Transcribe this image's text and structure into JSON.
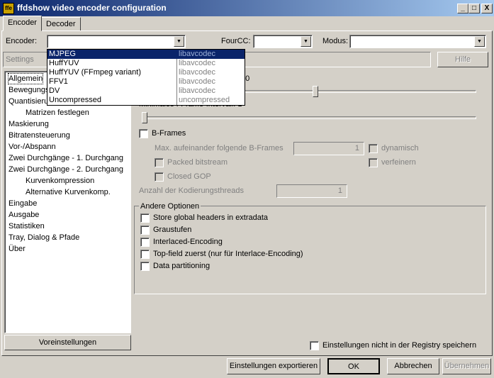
{
  "window": {
    "title": "ffdshow video encoder configuration",
    "icon_text": "ffe",
    "buttons": [
      "_",
      "□",
      "X"
    ]
  },
  "tabs": [
    {
      "label": "Encoder",
      "active": true
    },
    {
      "label": "Decoder",
      "active": false
    }
  ],
  "top": {
    "encoder_label": "Encoder:",
    "encoder_value": "",
    "fourcc_label": "FourCC:",
    "fourcc_value": "",
    "modus_label": "Modus:",
    "modus_value": "",
    "settings_label": "Settings",
    "help_button": "Hilfe"
  },
  "dropdown": {
    "items": [
      {
        "name": "MJPEG",
        "lib": "libavcodec",
        "selected": true
      },
      {
        "name": "HuffYUV",
        "lib": "libavcodec",
        "selected": false
      },
      {
        "name": "HuffYUV (FFmpeg variant)",
        "lib": "libavcodec",
        "selected": false
      },
      {
        "name": "FFV1",
        "lib": "libavcodec",
        "selected": false
      },
      {
        "name": "DV",
        "lib": "libavcodec",
        "selected": false
      },
      {
        "name": "Uncompressed",
        "lib": "uncompressed",
        "selected": false
      }
    ]
  },
  "tree": {
    "items": [
      {
        "label": "Allgemein",
        "indent": 0,
        "selected": true
      },
      {
        "label": "Bewegungs",
        "indent": 0
      },
      {
        "label": "Quantisieru",
        "indent": 0
      },
      {
        "label": "Matrizen festlegen",
        "indent": 1
      },
      {
        "label": "Maskierung",
        "indent": 0
      },
      {
        "label": "Bitratensteuerung",
        "indent": 0
      },
      {
        "label": "Vor-/Abspann",
        "indent": 0
      },
      {
        "label": "Zwei Durchgänge - 1. Durchgang",
        "indent": 0
      },
      {
        "label": "Zwei Durchgänge - 2. Durchgang",
        "indent": 0
      },
      {
        "label": "Kurvenkompression",
        "indent": 1
      },
      {
        "label": "Alternative Kurvenkomp.",
        "indent": 1
      },
      {
        "label": "Eingabe",
        "indent": 0
      },
      {
        "label": "Ausgabe",
        "indent": 0
      },
      {
        "label": "Statistiken",
        "indent": 0
      },
      {
        "label": "Tray, Dialog & Pfade",
        "indent": 0
      },
      {
        "label": "Über",
        "indent": 0
      }
    ]
  },
  "presets_button": "Voreinstellungen",
  "main": {
    "slider1_label_partial": "50",
    "slider1_level": 0.52,
    "slider2_label": "Minimales I-Frame-Intervall: 1",
    "slider2_level": 0.0,
    "bframes_label": "B-Frames",
    "max_bframes_label": "Max. aufeinander folgende B-Frames",
    "max_bframes_value": "1",
    "dynamisch_label": "dynamisch",
    "packed_label": "Packed bitstream",
    "verfeinern_label": "verfeinern",
    "closed_gop_label": "Closed GOP",
    "threads_label": "Anzahl der Kodierungsthreads",
    "threads_value": "1"
  },
  "other_options": {
    "title": "Andere Optionen",
    "items": [
      "Store global headers in extradata",
      "Graustufen",
      "Interlaced-Encoding",
      "Top-field zuerst (nur für Interlace-Encoding)",
      "Data partitioning"
    ]
  },
  "registry_label": "Einstellungen nicht in der Registry speichern",
  "bottom_buttons": {
    "export": "Einstellungen exportieren",
    "ok": "OK",
    "cancel": "Abbrechen",
    "apply": "Übernehmen"
  },
  "colors": {
    "title_start": "#0a246a",
    "title_end": "#a6caf0",
    "face": "#d4d0c8",
    "selection": "#0a246a"
  }
}
